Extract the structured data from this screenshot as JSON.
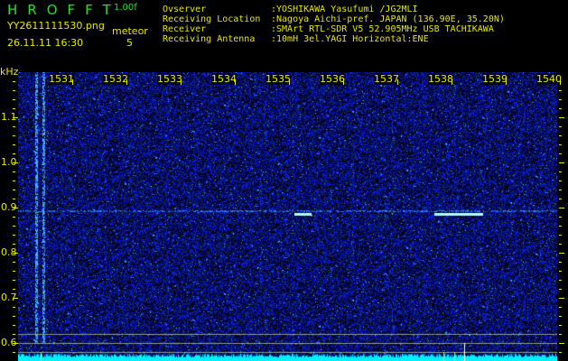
{
  "header": {
    "app_title": "HROFFT",
    "version": "1.00f",
    "filename": "YY2611111530.png",
    "datetime": "26.11.11 16:30",
    "meteor_label": "meteor",
    "meteor_count": "5"
  },
  "info": [
    {
      "key": "Ovserver",
      "value": ":YOSHIKAWA Yasufumi /JG2MLI"
    },
    {
      "key": "Receiving Location",
      "value": ":Nagoya Aichi-pref. JAPAN (136.90E, 35.20N)"
    },
    {
      "key": "Receiver",
      "value": ":SMArt RTL-SDR V5 52.905MHz USB TACHIKAWA"
    },
    {
      "key": "Receiving Antenna",
      "value": ":10mH 3el.YAGI Horizontal:ENE"
    }
  ],
  "axis": {
    "y_unit": "kHz",
    "y_labels": [
      "1.1",
      "1.0",
      "0.9",
      "0.8",
      "0.7",
      "0.6"
    ],
    "x_labels": [
      "1531",
      "1532",
      "1533",
      "1534",
      "1535",
      "1536",
      "1537",
      "1538",
      "1539",
      "1540"
    ]
  },
  "colors": {
    "text": "#e8e800",
    "title": "#22e022",
    "noise": "#1a2cff",
    "level": "#00f0ff"
  }
}
